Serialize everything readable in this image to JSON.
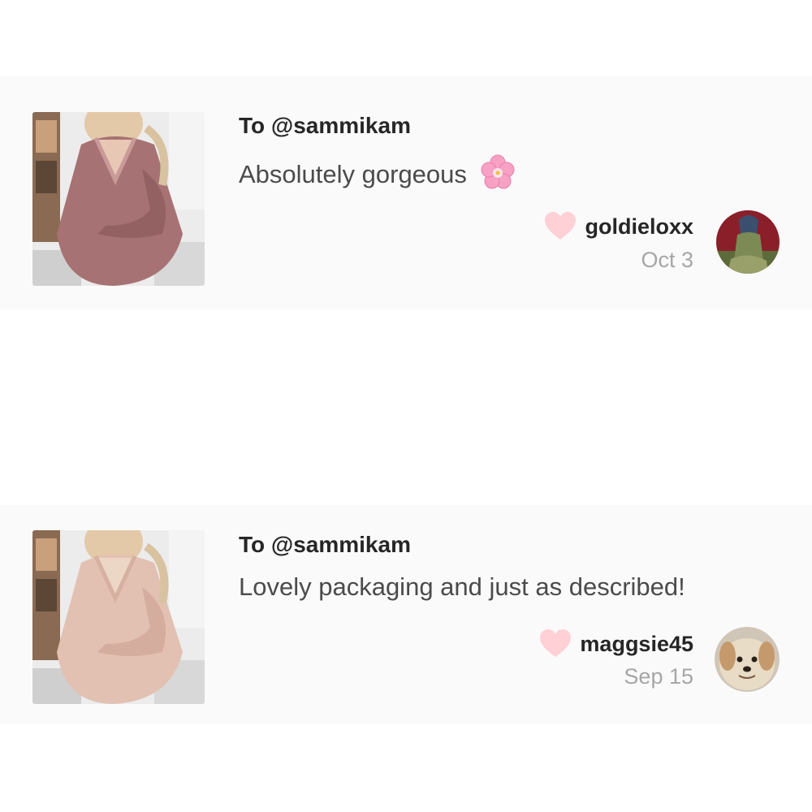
{
  "reviews": [
    {
      "to": "To @sammikam",
      "comment": "Absolutely gorgeous",
      "emoji": "cherry-blossom-icon",
      "username": "goldieloxx",
      "date": "Oct 3",
      "sweater_color": "#a77273",
      "heart_color": "#ffd0d6"
    },
    {
      "to": "To @sammikam",
      "comment": "Lovely packaging and just as described!",
      "username": "maggsie45",
      "date": "Sep 15",
      "sweater_color": "#e2c1b3",
      "heart_color": "#ffd0d6"
    }
  ]
}
